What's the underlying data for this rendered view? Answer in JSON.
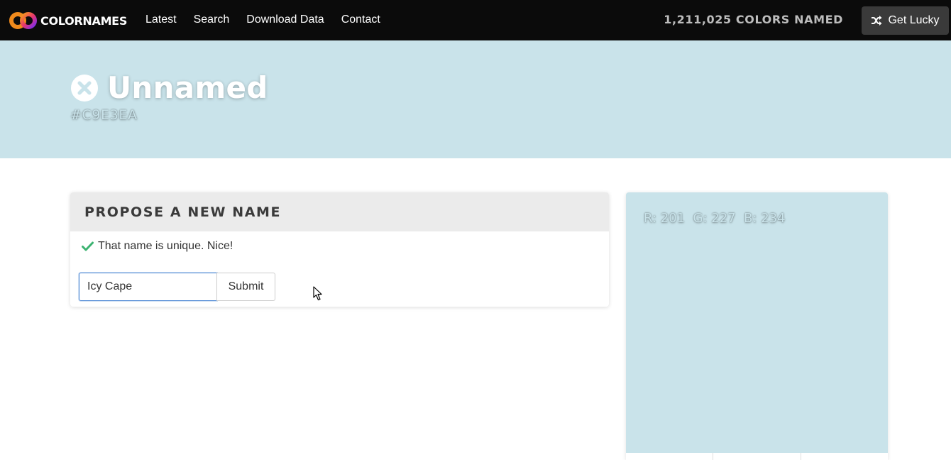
{
  "navbar": {
    "brand": "COLORNAMES",
    "links": [
      "Latest",
      "Search",
      "Download Data",
      "Contact"
    ],
    "colors_count": "1,211,025 COLORS NAMED",
    "lucky_label": "Get Lucky",
    "lucky_icon": "shuffle-icon"
  },
  "hero": {
    "status_icon": "close-circle-icon",
    "title": "Unnamed",
    "hex": "#C9E3EA",
    "background_color": "#c9e3ea"
  },
  "propose": {
    "title": "PROPOSE A NEW NAME",
    "success_icon": "checkmark-icon",
    "success_message": "That name is unique. Nice!",
    "input_value": "Icy Cape",
    "submit_label": "Submit"
  },
  "color_panel": {
    "rgb": "R: 201  G: 227  B: 234"
  },
  "colors": {
    "accent_success": "#3cb371",
    "navbar_bg": "#0b0b0b",
    "input_focus": "#4b87d4"
  }
}
